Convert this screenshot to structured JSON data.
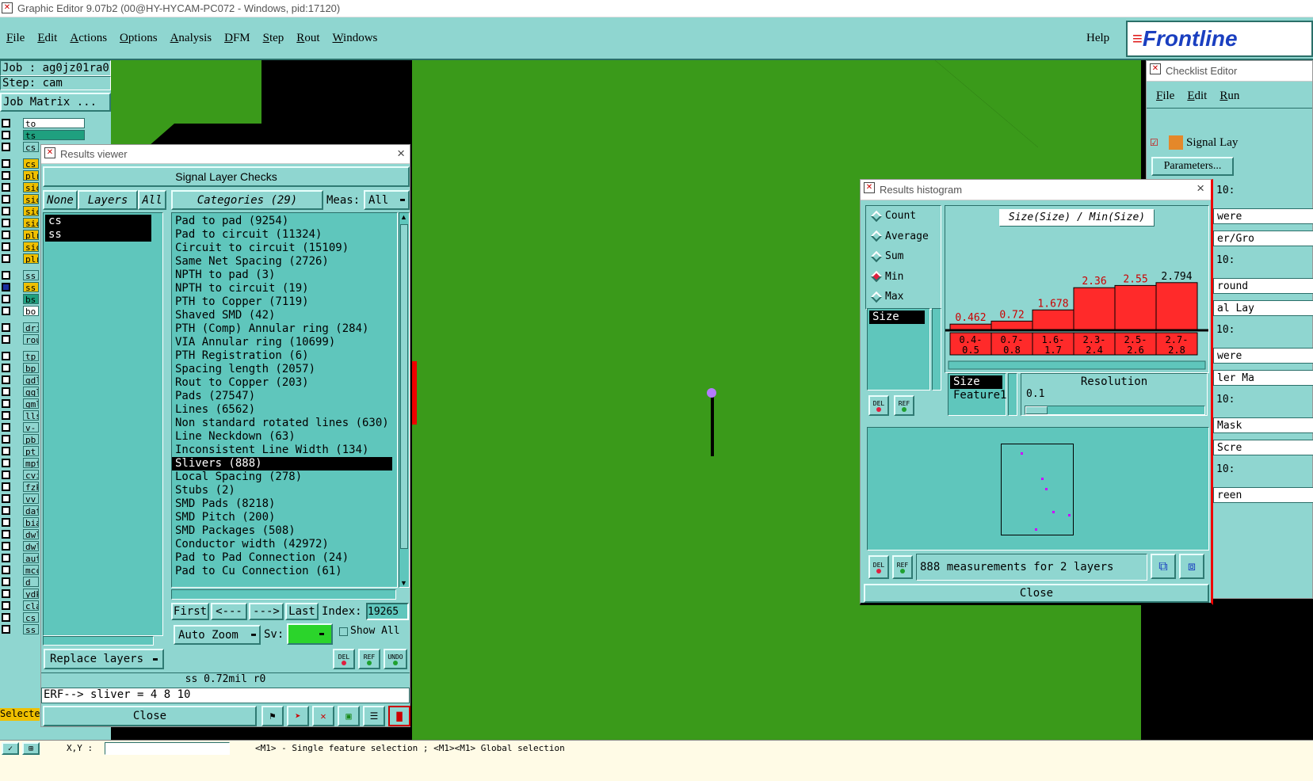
{
  "app": {
    "title": "Graphic Editor 9.07b2 (00@HY-HYCAM-PC072 - Windows, pid:17120)",
    "menu": [
      "File",
      "Edit",
      "Actions",
      "Options",
      "Analysis",
      "DFM",
      "Step",
      "Rout",
      "Windows"
    ],
    "help": "Help",
    "logo": "Frontline"
  },
  "job": {
    "job_line": "Job : ag0jz01ra0",
    "step_line": "Step: cam",
    "matrix_btn": "Job Matrix ..."
  },
  "layers": [
    "to",
    "ts",
    "cs.",
    "cs",
    "plr",
    "sic",
    "sic",
    "sic",
    "sic",
    "plr",
    "sic",
    "plr",
    "ss.",
    "ss",
    "bs",
    "bo",
    "dri",
    "rou",
    "tp",
    "bp",
    "gdl",
    "ggl",
    "gml",
    "lls",
    "v-c",
    "pb",
    "pt",
    "mpt",
    "cvi",
    "fzk",
    "vv",
    "dat",
    "bia",
    "dwl",
    "dwl",
    "aut",
    "mcc",
    "d",
    "ydk",
    "cla",
    "cs_",
    "ss_"
  ],
  "left_footer": "Selected",
  "results": {
    "title": "Results viewer",
    "header": "Signal Layer Checks",
    "none_btn": "None",
    "layers_btn": "Layers",
    "all_btn": "All",
    "categories_btn": "Categories (29)",
    "meas_label": "Meas:",
    "meas_value": "All",
    "layer_items": [
      "cs",
      "ss"
    ],
    "categories": [
      "Pad to pad (9254)",
      "Pad to circuit (11324)",
      "Circuit to circuit (15109)",
      "Same Net Spacing (2726)",
      "NPTH to pad (3)",
      "NPTH to circuit (19)",
      "PTH to Copper (7119)",
      "Shaved SMD (42)",
      "PTH (Comp) Annular ring (284)",
      "VIA Annular ring (10699)",
      "PTH Registration (6)",
      "Spacing length (2057)",
      "Rout to Copper (203)",
      "Pads (27547)",
      "Lines (6562)",
      "Non standard rotated lines (630)",
      "Line Neckdown (63)",
      "Inconsistent Line Width (134)",
      "Slivers (888)",
      "Local Spacing (278)",
      "Stubs (2)",
      "SMD Pads (8218)",
      "SMD Pitch (200)",
      "SMD Packages (508)",
      "Conductor width (42972)",
      "Pad to Pad Connection (24)",
      "Pad to Cu Connection (61)"
    ],
    "selected_category": "Slivers (888)",
    "first_btn": "First",
    "prev_btn": "<---",
    "next_btn": "--->",
    "last_btn": "Last",
    "index_label": "Index:",
    "index_value": "19265",
    "autozoom": "Auto Zoom",
    "sv_label": "Sv:",
    "show_all": "Show All",
    "replace_layers": "Replace layers",
    "del": "DEL",
    "ref": "REF",
    "undo": "UNDO",
    "status": "ss 0.72mil  r0",
    "erf": "ERF--> sliver = 4 8 10",
    "close": "Close"
  },
  "histogram": {
    "title": "Results histogram",
    "modes": [
      "Count",
      "Average",
      "Sum",
      "Min",
      "Max"
    ],
    "selected_mode": "Min",
    "chart_title": "Size(Size) / Min(Size)",
    "list_item": "Size",
    "attrs": [
      "Size",
      "Feature1"
    ],
    "resolution_label": "Resolution",
    "resolution_value": "0.1",
    "summary": "888 measurements for 2 layers",
    "close": "Close",
    "del": "DEL",
    "ref": "REF"
  },
  "chart_data": {
    "type": "bar",
    "title": "Size(Size) / Min(Size)",
    "categories": [
      "0.4-0.5",
      "0.7-0.8",
      "1.6-1.7",
      "2.3-2.4",
      "2.5-2.6",
      "2.7-2.8"
    ],
    "values": [
      0.462,
      0.72,
      1.678,
      2.36,
      2.55,
      2.794
    ],
    "xlabel": "",
    "ylabel": ""
  },
  "checklist": {
    "title": "Checklist Editor",
    "menu": [
      "File",
      "Edit",
      "Run"
    ],
    "signal": "Signal Lay",
    "params": "Parameters...",
    "side_texts": [
      "10:",
      "were",
      "er/Gro",
      "10:",
      "round",
      "al Lay",
      "10:",
      "were",
      "ler Ma",
      "10:",
      "Mask",
      "Scre",
      "10:",
      "reen"
    ]
  },
  "statusbar": {
    "xy": "X,Y :",
    "hint": "<M1> - Single feature selection ; <M1><M1> Global selection"
  }
}
